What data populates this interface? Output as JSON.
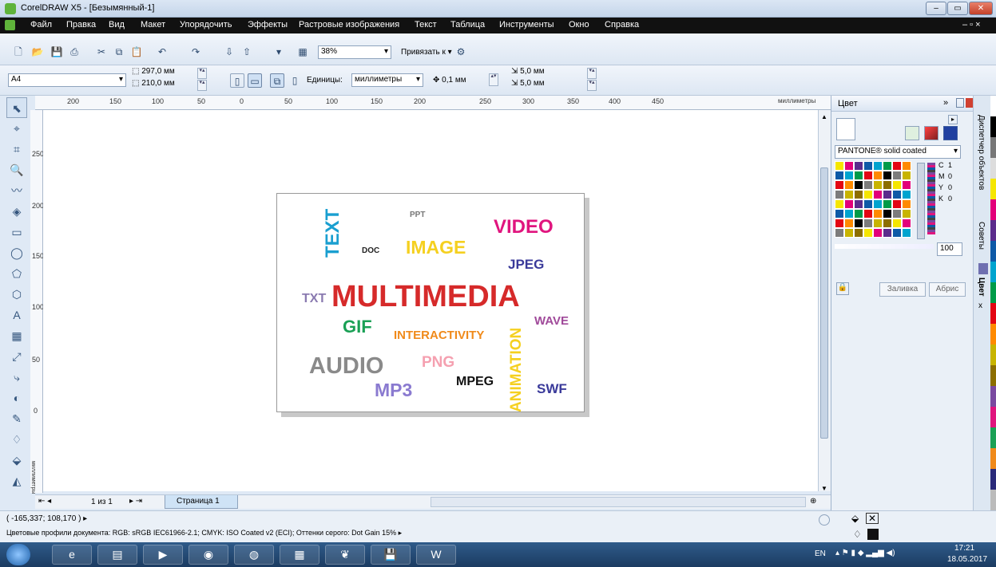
{
  "window": {
    "title": "CorelDRAW X5 - [Безымянный-1]",
    "controls": [
      "–",
      "▭",
      "✕"
    ]
  },
  "menu": [
    "Файл",
    "Правка",
    "Вид",
    "Макет",
    "Упорядочить",
    "Эффекты",
    "Растровые изображения",
    "Текст",
    "Таблица",
    "Инструменты",
    "Окно",
    "Справка"
  ],
  "menu_right": "– ▫ ×",
  "toolbar": {
    "zoom": "38%",
    "snap_label": "Привязать к"
  },
  "propbar": {
    "page_size": "A4",
    "width": "297,0 мм",
    "height": "210,0 мм",
    "units_label": "Единицы:",
    "units_value": "миллиметры",
    "nudge": "0,1 мм",
    "dup_x": "5,0 мм",
    "dup_y": "5,0 мм"
  },
  "ruler": {
    "top": [
      "200",
      "150",
      "100",
      "50",
      "0",
      "50",
      "100",
      "150",
      "200",
      "250",
      "300",
      "350",
      "400",
      "450"
    ],
    "units": "миллиметры",
    "left": [
      "250",
      "200",
      "150",
      "100",
      "50",
      "0"
    ],
    "left_units": "миллиметры"
  },
  "words": [
    {
      "text": "TEXT",
      "color": "#1a9fd0"
    },
    {
      "text": "PPT",
      "color": "#777777"
    },
    {
      "text": "VIDEO",
      "color": "#e0157e"
    },
    {
      "text": "DOC",
      "color": "#222222"
    },
    {
      "text": "IMAGE",
      "color": "#f5d020"
    },
    {
      "text": "JPEG",
      "color": "#3a3a9a"
    },
    {
      "text": "TXT",
      "color": "#8a7ab0"
    },
    {
      "text": "MULTIMEDIA",
      "color": "#d62a2a"
    },
    {
      "text": "GIF",
      "color": "#1aa055"
    },
    {
      "text": "WAVE",
      "color": "#a04a9a"
    },
    {
      "text": "INTERACTIVITY",
      "color": "#f08a1a"
    },
    {
      "text": "ANIMATION",
      "color": "#f5d020"
    },
    {
      "text": "AUDIO",
      "color": "#8a8a8a"
    },
    {
      "text": "PNG",
      "color": "#f5a0b0"
    },
    {
      "text": "MPEG",
      "color": "#111111"
    },
    {
      "text": "MP3",
      "color": "#8a7ad0"
    },
    {
      "text": "SWF",
      "color": "#3a3a9a"
    }
  ],
  "pages": {
    "counter": "1 из 1",
    "tab": "Страница 1"
  },
  "color_panel": {
    "title": "Цвет",
    "palette": "PANTONE® solid coated",
    "c_label": "C",
    "c_value": "1",
    "m_label": "M",
    "m_value": "0",
    "y_label": "Y",
    "y_value": "0",
    "k_label": "K",
    "k_value": "0",
    "tint": "100",
    "fill_button": "Заливка",
    "outline_button": "Абрис"
  },
  "side_tabs": [
    "Диспетчер объектов",
    "Советы",
    "Цвет"
  ],
  "status": {
    "coords": "( -165,337; 108,170 )",
    "profiles": "Цветовые профили документа: RGB: sRGB IEC61966-2.1; CMYK: ISO Coated v2 (ECI); Оттенки серого: Dot Gain 15%"
  },
  "taskbar": {
    "lang": "EN",
    "time": "17:21",
    "date": "18.05.2017"
  },
  "colors": {
    "swatches": [
      "#f5e600",
      "#e3007a",
      "#5b2c8c",
      "#0e5aa7",
      "#00a4cf",
      "#009b48",
      "#e30613",
      "#ff8a00",
      "#000000",
      "#7c7c7c",
      "#c8b400",
      "#8c6e00"
    ]
  }
}
